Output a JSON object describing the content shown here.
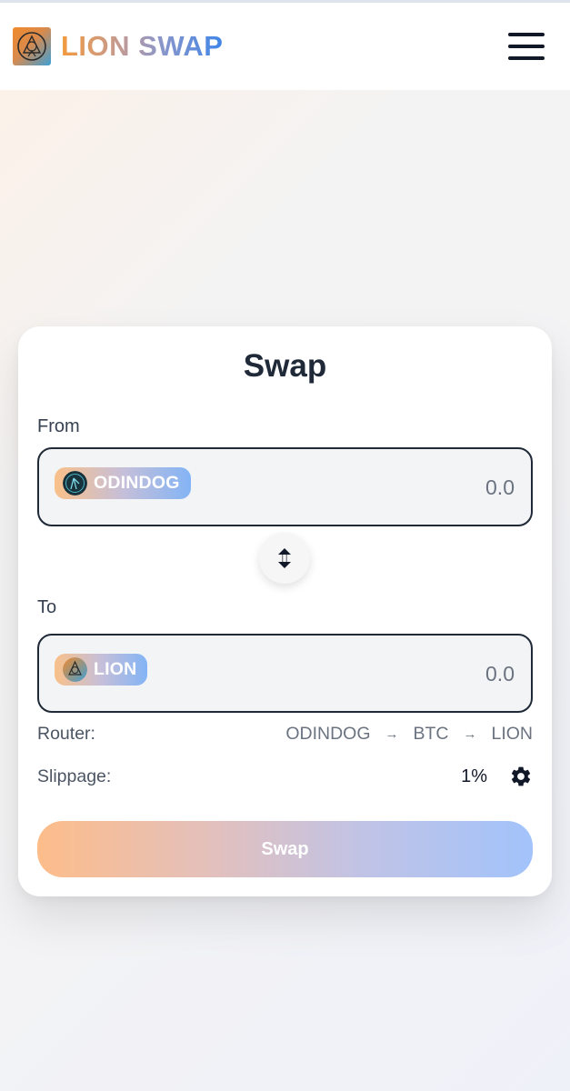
{
  "header": {
    "brand": "LION SWAP",
    "logo_icon": "lion-logo-icon",
    "menu_icon": "hamburger-menu-icon"
  },
  "swap": {
    "title": "Swap",
    "from": {
      "label": "From",
      "token": "ODINDOG",
      "amount_placeholder": "0.0"
    },
    "to": {
      "label": "To",
      "token": "LION",
      "amount_placeholder": "0.0"
    },
    "switch_icon": "swap-vertical-icon",
    "router": {
      "label": "Router:",
      "route": [
        "ODINDOG",
        "BTC",
        "LION"
      ],
      "separator": "→"
    },
    "slippage": {
      "label": "Slippage:",
      "value": "1%",
      "settings_icon": "gear-icon"
    },
    "submit_label": "Swap"
  },
  "colors": {
    "brand_orange": "#f29a3e",
    "brand_blue": "#3f86e8",
    "border_dark": "#1f2937"
  }
}
